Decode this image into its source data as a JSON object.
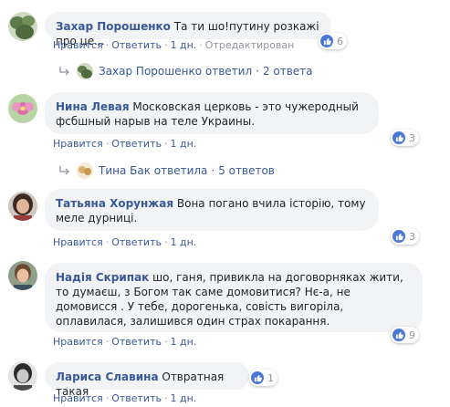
{
  "actions": {
    "like": "Нравится",
    "reply": "Ответить",
    "dot": "·"
  },
  "comments": [
    {
      "author": "Захар Порошенко",
      "text": "Та ти шо!путину розкажі про це...",
      "time": "1 дн.",
      "edited": "Отредактирован",
      "likes": "6",
      "replies": {
        "label": "Захар Порошенко ответил",
        "count": "2 ответа"
      }
    },
    {
      "author": "Нина Левая",
      "text": "Московская церковь - это чужеродный фсбшный нарыв на теле Украины.",
      "time": "1 дн.",
      "likes": "3",
      "replies": {
        "label": "Тина Бак ответила",
        "count": "5 ответов"
      }
    },
    {
      "author": "Татьяна Хорунжая",
      "text": "Вона погано вчила історію, тому меле дурниці.",
      "time": "1 дн.",
      "likes": "3"
    },
    {
      "author": "Надія Скрипак",
      "text": "шо, ганя, привикла на договорняках жити, то думаєш, з Богом так саме домовитися? Нє-а, не домовисся . У тебе, дорогенька, совість вигоріла, оплавилася, залишився один страх покарання.",
      "time": "1 дн.",
      "likes": "9"
    },
    {
      "author": "Лариса Славина",
      "text": "Отвратная такая",
      "time": "1 дн.",
      "likes": "1"
    }
  ],
  "colors": {
    "link": "#385898",
    "bubble": "#f2f3f5",
    "meta": "#90949c",
    "like_blue": "#4a76d8"
  },
  "icons": {
    "like": "thumbs-up-icon",
    "reply": "reply-arrow-icon"
  }
}
